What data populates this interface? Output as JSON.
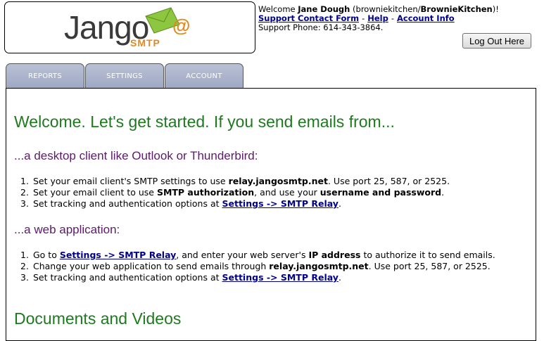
{
  "logo": {
    "word": "Jango",
    "sub": "SMTP",
    "at": "@"
  },
  "header": {
    "welcome_prefix": "Welcome ",
    "user_name": "Jane Dough",
    "account_open": " (",
    "account_user": "browniekitchen",
    "account_slash": "/",
    "account_company": "BrownieKitchen",
    "account_close": ")!",
    "links": [
      "Support Contact Form",
      "Help",
      "Account Info"
    ],
    "link_sep": "-",
    "phone": "Support Phone: 614-343-3864.",
    "logout_label": "Log Out Here"
  },
  "tabs": [
    "REPORTS",
    "SETTINGS",
    "ACCOUNT"
  ],
  "main": {
    "title": "Welcome. Let's get started. If you send emails from...",
    "section1": {
      "heading": "...a desktop client like Outlook or Thunderbird:",
      "steps": [
        {
          "num": "1.",
          "parts": [
            "Set your email client's SMTP settings to use ",
            "relay.jangosmtp.net",
            ". Use port 25, 587, or 2525."
          ]
        },
        {
          "num": "2.",
          "parts": [
            "Set your email client to use ",
            "SMTP authorization",
            ", and use your ",
            "username and password",
            "."
          ]
        },
        {
          "num": "3.",
          "parts": [
            "Set tracking and authentication options at ",
            "Settings -> SMTP Relay",
            "."
          ]
        }
      ]
    },
    "section2": {
      "heading": "...a web application:",
      "steps": [
        {
          "num": "1.",
          "parts": [
            "Go to ",
            "Settings -> SMTP Relay",
            ", and enter your web server's ",
            "IP address",
            " to authorize it to send emails."
          ]
        },
        {
          "num": "2.",
          "parts": [
            "Change your web application to send emails through ",
            "relay.jangosmtp.net",
            ". Use port 25, 587, or 2525."
          ]
        },
        {
          "num": "3.",
          "parts": [
            "Set tracking and authentication options at ",
            "Settings -> SMTP Relay",
            "."
          ]
        }
      ]
    },
    "docs_heading": "Documents and Videos"
  },
  "colors": {
    "heading_green": "#1e7a1e",
    "subheading_purple": "#5c1a6b",
    "link_blue": "#00008b",
    "tab_blue": "#9ea8c2",
    "logo_orange": "#e08a1e",
    "envelope_green": "#8dc63f"
  }
}
